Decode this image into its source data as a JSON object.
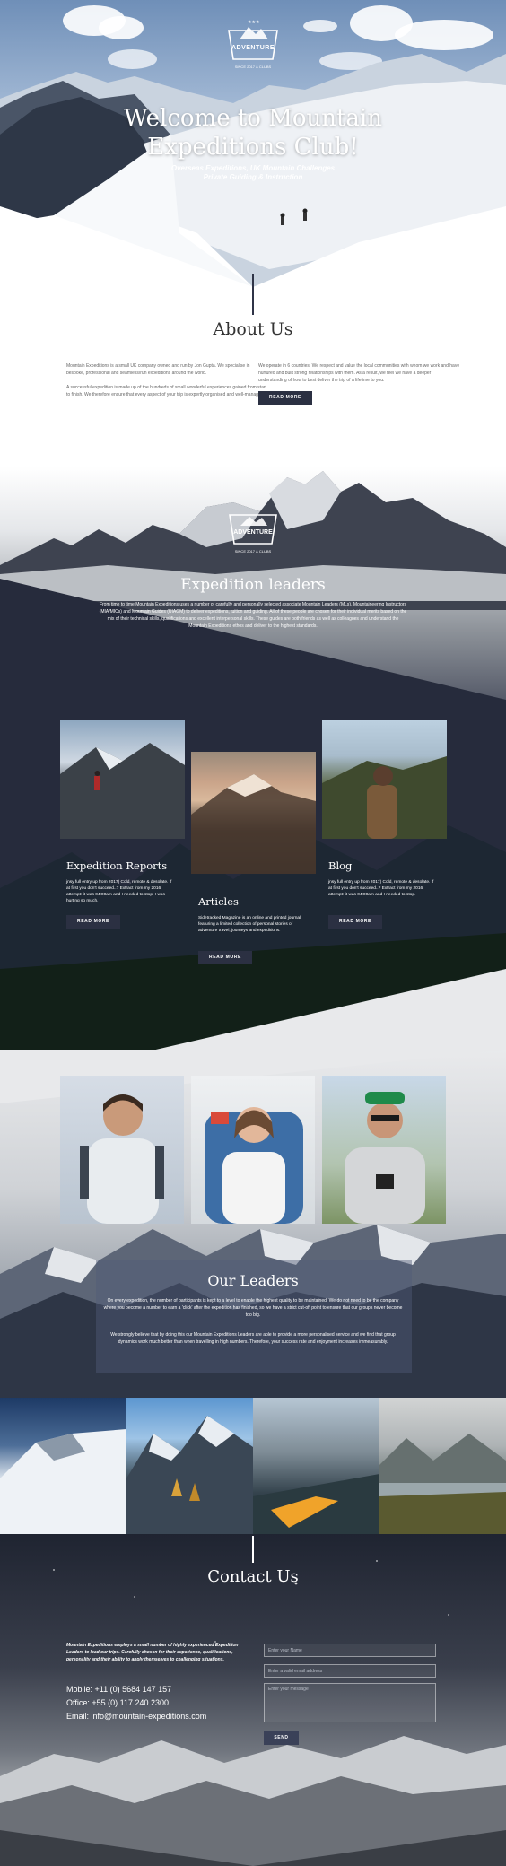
{
  "hero": {
    "logo_text": "ADVENTURE",
    "logo_tagline": "SINCE 2017 & CLUBS",
    "title_line1": "Welcome to Mountain",
    "title_line2": "Expeditions Club!",
    "subtitle_line1": "Overseas Expeditions, UK Mountain Challenges",
    "subtitle_line2": "Private Guiding & Instruction"
  },
  "about": {
    "title": "About Us",
    "left_p1": "Mountain Expeditions is a small UK company owned and run by Jon Gupta. We specialise in bespoke, professional and seamless/run expeditions around the world.",
    "left_p2": "A successful expedition is made up of the hundreds of small wonderful experiences gained from start to finish. We therefore ensure that every aspect of your trip is expertly organised and well-managed.",
    "right_p1": "We operate in 6 countries. We respect and value the local communities with whom we work and have nurtured and built strong relationships with them. As a result, we feel we have a deeper understanding of how to best deliver the trip of a lifetime to you.",
    "button": "READ MORE"
  },
  "leaders": {
    "logo_text": "ADVENTURE",
    "logo_tagline": "SINCE 2017 & CLUBS",
    "title": "Expedition leaders",
    "text": "From time to time Mountain Expeditions uses a number of carefully and personally selected associate Mountain Leaders (MLs), Mountaineering Instructors (MIA/MICs) and Mountain Guides (UIAGM) to deliver expeditions, tuition and guiding. All of these people are chosen for their individual merits based on the mix of their technical skills, qualifications and excellent interpersonal skills. These guides are both friends as well as colleagues and understand the Mountain Expeditions ethos and deliver to the highest standards."
  },
  "cards": [
    {
      "title": "Expedition Reports",
      "text": "jnsy full entry up from 2017) Cold, remote & desolate. If at first you don't succeed..? Extract from my 2016 attempt: it was 04:00am and I needed to stop. I was hurting so much.",
      "button": "READ MORE"
    },
    {
      "title": "Articles",
      "text": "Sidetracked Magazine is an online and printed journal featuring a limited collection of personal stories of adventure travel, journeys and expeditions.",
      "button": "READ MORE"
    },
    {
      "title": "Blog",
      "text": "jnsy full entry up from 2017) Cold, remote & desolate. If at first you don't succeed..? Extract from my 2016 attempt: it was 04:00am and I needed to stop.",
      "button": "READ MORE"
    }
  ],
  "our_leaders": {
    "title": "Our Leaders",
    "p1": "On every expedition, the number of participants is kept to a level to enable the highest quality to be maintained. We do not need to be the company where you become a number to earn a 'click' after the expedition has finished, so we have a strict cut-off point to ensure that our groups never become too big.",
    "p2": "We strongly believe that by doing this our Mountain Expeditions Leaders are able to provide a more personalised service and we find that group dynamics work much better than when travelling in high numbers. Therefore, your success rate and enjoyment increases immeasurably."
  },
  "contact": {
    "title": "Contact Us",
    "intro": "Mountain Expeditions employs a small number of highly experienced Expedition Leaders to lead our trips. Carefully chosen for their experience, qualifications, personality and their ability to apply themselves to challenging situations.",
    "mobile": "Mobile: +11 (0) 5684 147 157",
    "office": "Office: +55 (0) 117 240 2300",
    "email": "Email: info@mountain-expeditions.com",
    "name_placeholder": "Enter your Name",
    "email_placeholder": "Enter a valid email address",
    "message_placeholder": "Enter your message",
    "send": "SEND"
  },
  "colors": {
    "dark_navy": "#2b3042",
    "hero_sky": "#6f8fb8",
    "contact_bg": "#1f2431"
  }
}
